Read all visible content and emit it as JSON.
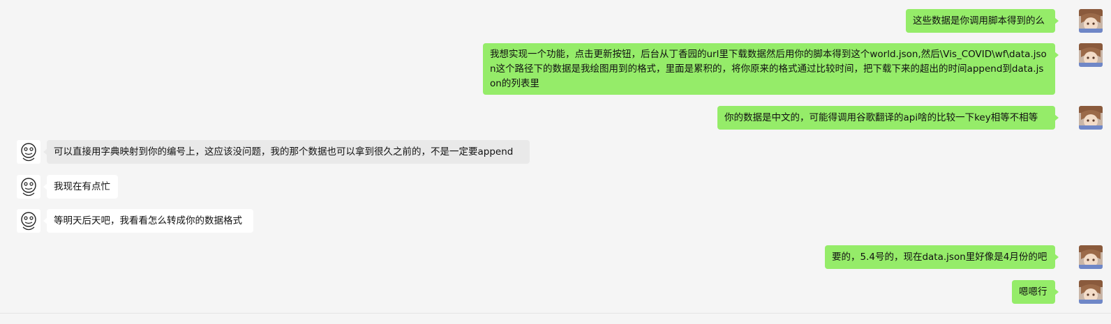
{
  "messages": [
    {
      "sender": "self",
      "text": "这些数据是你调用脚本得到的么"
    },
    {
      "sender": "self",
      "text": "我想实现一个功能，点击更新按钮，后台从丁香园的url里下载数据然后用你的脚本得到这个world.json,然后\\Vis_COVID\\wf\\data.json这个路径下的数据是我绘图用到的格式，里面是累积的，将你原来的格式通过比较时间，把下载下来的超出的时间append到data.json的列表里"
    },
    {
      "sender": "self",
      "text": "你的数据是中文的，可能得调用谷歌翻译的api啥的比较一下key相等不相等"
    },
    {
      "sender": "peer",
      "text": "可以直接用字典映射到你的编号上，这应该没问题，我的那个数据也可以拿到很久之前的，不是一定要append"
    },
    {
      "sender": "peer",
      "text": "我现在有点忙"
    },
    {
      "sender": "peer",
      "text": "等明天后天吧，我看看怎么转成你的数据格式"
    },
    {
      "sender": "self",
      "text": "要的，5.4号的，现在data.json里好像是4月份的吧"
    },
    {
      "sender": "self",
      "text": "嗯嗯行"
    }
  ],
  "avatars": {
    "self": "anime-avatar-icon",
    "peer": "meme-face-avatar-icon"
  },
  "colors": {
    "background": "#f5f5f5",
    "self_bubble": "#95ec69",
    "peer_bubble": "#ffffff"
  }
}
